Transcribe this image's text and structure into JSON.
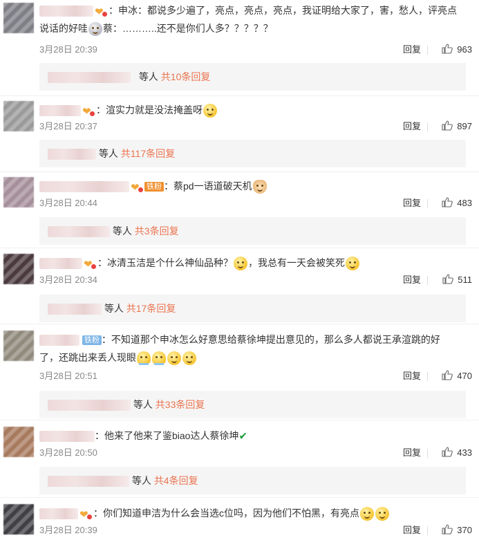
{
  "colors": {
    "accent": "#eb7350",
    "meta": "#888888",
    "sub_bg": "#f5f5f5"
  },
  "comments": [
    {
      "badge": "heart",
      "line1": "：申冰：都说多少遍了，亮点，亮点，亮点，我证明给大家了，害，愁人，评亮点",
      "line2_a": "说话的好哇",
      "line2_b": "蔡：………..还不是你们人多？？？？？",
      "time": "3月28日 20:39",
      "reply": "回复",
      "likes": "963",
      "sub_others": "等人",
      "sub_count": "共10条回复"
    },
    {
      "badge": "heart",
      "line1": "：渲实力就是没法掩盖呀",
      "time": "3月28日 20:37",
      "reply": "回复",
      "likes": "897",
      "sub_others": "等人",
      "sub_count": "共117条回复"
    },
    {
      "badge": "heart",
      "tiefen": "铁粉",
      "line1": "：蔡pd一语道破天机",
      "time": "3月28日 20:44",
      "reply": "回复",
      "likes": "483",
      "sub_others": "等人",
      "sub_count": "共3条回复"
    },
    {
      "badge": "heart",
      "line1_a": "：冰清玉洁是个什么神仙品种？",
      "line1_b": "，我总有一天会被笑死",
      "time": "3月28日 20:34",
      "reply": "回复",
      "likes": "511",
      "sub_others": "等人",
      "sub_count": "共17条回复"
    },
    {
      "tiefen": "铁粉",
      "line1": "：不知道那个申冰怎么好意思给蔡徐坤提出意见的，那么多人都说王承渲跳的好",
      "line2": "了，还跳出来丢人现眼",
      "time": "3月28日 20:51",
      "reply": "回复",
      "likes": "470",
      "sub_others": "等人",
      "sub_count": "共33条回复"
    },
    {
      "line1": "：他来了他来了鉴biao达人蔡徐坤",
      "time": "3月28日 20:50",
      "reply": "回复",
      "likes": "433",
      "sub_others": "等人",
      "sub_count": "共4条回复"
    },
    {
      "badge": "heart",
      "line1": "：你们知道申洁为什么会当选c位吗，因为他们不怕黑，有亮点",
      "time": "3月28日 20:39",
      "reply": "回复",
      "likes": "370"
    }
  ],
  "icons": {
    "like": "thumbs-up-icon",
    "emoji": "smile-emoji-icon",
    "check": "check-mark-icon"
  }
}
